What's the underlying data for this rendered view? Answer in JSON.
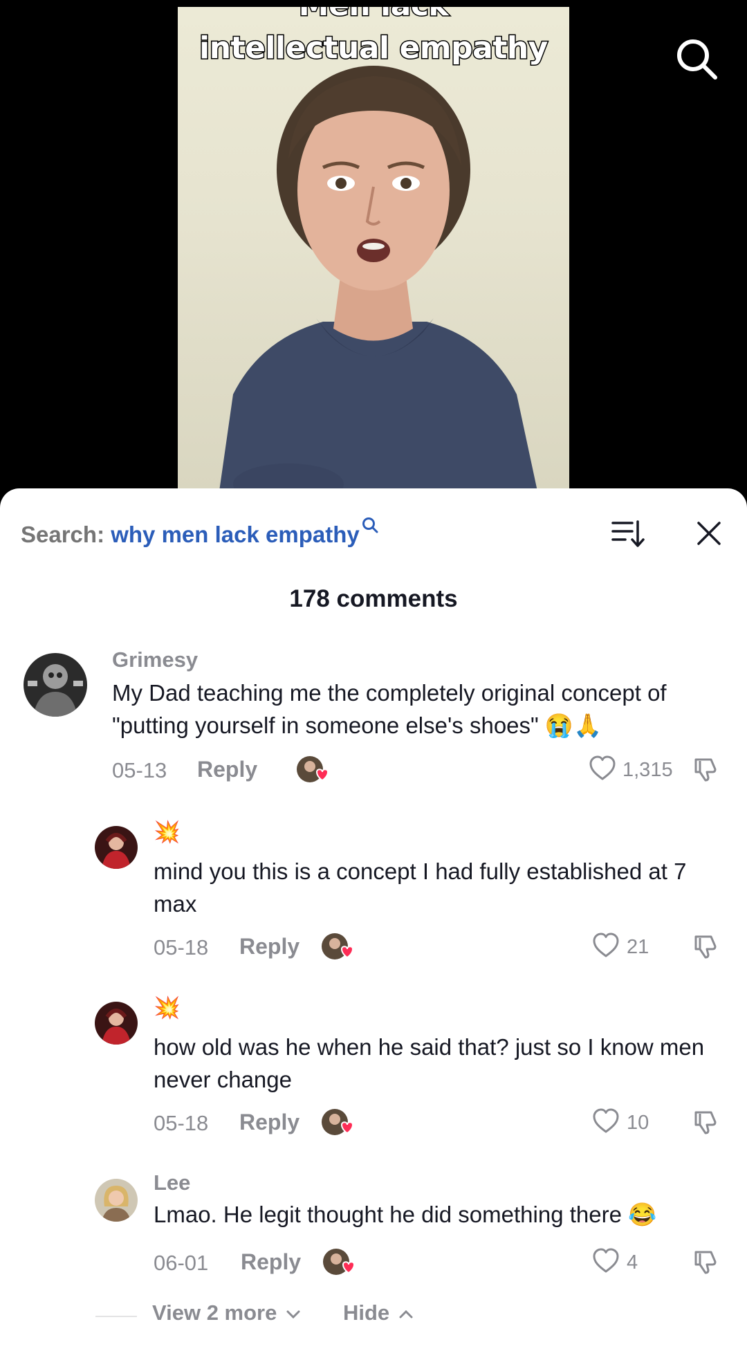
{
  "video": {
    "caption_top": "Men lack",
    "caption_main": "intellectual empathy"
  },
  "header": {
    "search_prefix": "Search:",
    "search_query": "why men lack empathy",
    "comment_count": "178 comments"
  },
  "comments": [
    {
      "username": "Grimesy",
      "text": "My Dad teaching me the completely original concept of \"putting yourself in someone else's shoes\" 😭🙏",
      "date": "05-13",
      "reply_label": "Reply",
      "likes": "1,315"
    },
    {
      "username": "💥",
      "text": "mind you this is a concept I had fully established at 7 max",
      "date": "05-18",
      "reply_label": "Reply",
      "likes": "21"
    },
    {
      "username": "💥",
      "text": "how old was he when he said that? just so I know men never change",
      "date": "05-18",
      "reply_label": "Reply",
      "likes": "10"
    },
    {
      "username": "Lee",
      "text": "Lmao. He legit thought he did something there 😂",
      "date": "06-01",
      "reply_label": "Reply",
      "likes": "4"
    }
  ],
  "footer": {
    "view_more": "View 2 more",
    "hide": "Hide"
  },
  "icons": {
    "search": "search-icon",
    "sort": "sort-icon",
    "close": "close-icon",
    "like": "heart-icon",
    "dislike": "thumbs-down-icon",
    "creator_liked": "creator-liked-badge"
  },
  "colors": {
    "query_link": "#2b5db9",
    "muted": "#8a8b91",
    "heart_badge": "#fe2c55"
  }
}
